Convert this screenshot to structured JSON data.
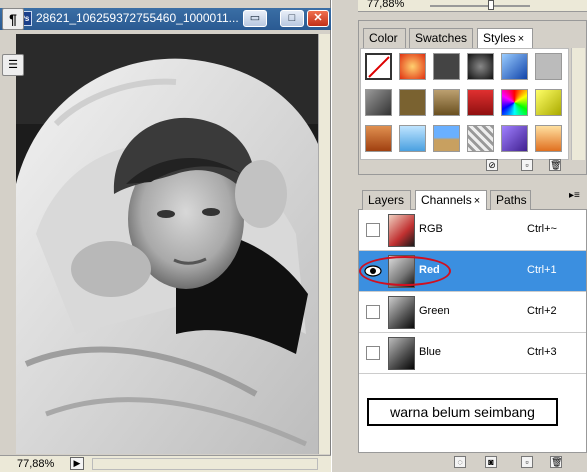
{
  "document": {
    "ps_icon_label": "Ps",
    "title": "28621_106259372755460_1000011...",
    "minimize_glyph": "▭",
    "maximize_glyph": "□",
    "close_glyph": "✕",
    "zoom": "77,88%",
    "status_icon_glyph": "▶"
  },
  "tool_strip": {
    "paragraph_glyph": "¶",
    "notes_glyph": "☰"
  },
  "info_strip": {
    "zoom": "77,88%",
    "zoom_slider_level": 0.61
  },
  "style_panel": {
    "tabs": [
      {
        "label": "Color"
      },
      {
        "label": "Swatches"
      },
      {
        "label": "Styles",
        "active": true
      }
    ],
    "close_glyph": "×",
    "footer_icons": [
      "no-style-icon",
      "new-style-icon",
      "delete-style-icon"
    ]
  },
  "channels_panel": {
    "tabs": [
      {
        "label": "Layers"
      },
      {
        "label": "Channels",
        "active": true
      },
      {
        "label": "Paths"
      }
    ],
    "close_glyph": "×",
    "menu_glyph": "▸≡",
    "channels": [
      {
        "name": "RGB",
        "shortcut": "Ctrl+~",
        "visible": false,
        "selected": false
      },
      {
        "name": "Red",
        "shortcut": "Ctrl+1",
        "visible": true,
        "selected": true
      },
      {
        "name": "Green",
        "shortcut": "Ctrl+2",
        "visible": false,
        "selected": false
      },
      {
        "name": "Blue",
        "shortcut": "Ctrl+3",
        "visible": false,
        "selected": false
      }
    ],
    "annotation": "warna belum seimbang",
    "footer_icons": [
      "load-selection-icon",
      "save-selection-icon",
      "new-channel-icon",
      "delete-channel-icon"
    ]
  },
  "colors": {
    "selected_row": "#3b8fe0",
    "annotation_ellipse": "#d01020",
    "titlebar": "#3a6ea5"
  }
}
